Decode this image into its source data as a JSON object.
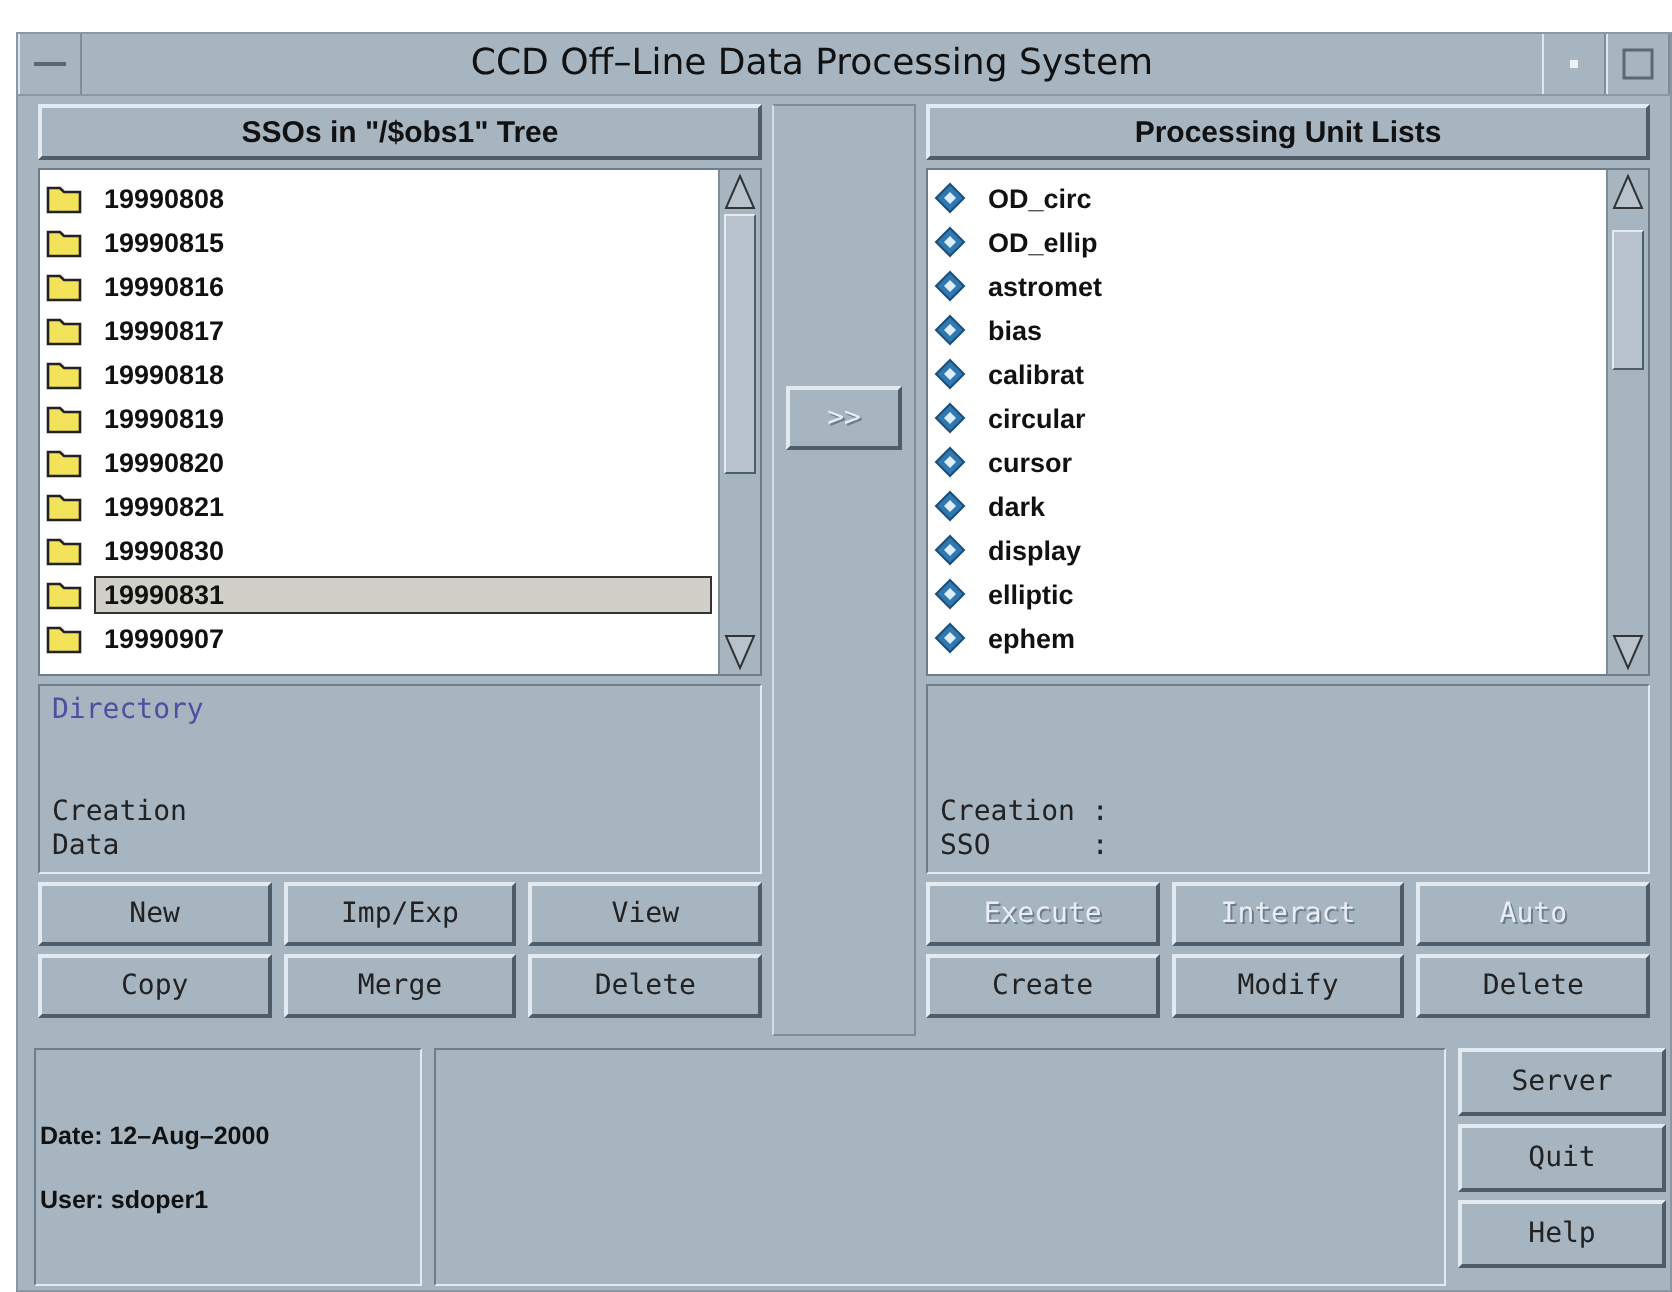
{
  "window": {
    "title": "CCD Off–Line Data Processing System"
  },
  "left_panel": {
    "header": "SSOs in \"/$obs1\" Tree",
    "items": [
      {
        "label": "19990808",
        "selected": false
      },
      {
        "label": "19990815",
        "selected": false
      },
      {
        "label": "19990816",
        "selected": false
      },
      {
        "label": "19990817",
        "selected": false
      },
      {
        "label": "19990818",
        "selected": false
      },
      {
        "label": "19990819",
        "selected": false
      },
      {
        "label": "19990820",
        "selected": false
      },
      {
        "label": "19990821",
        "selected": false
      },
      {
        "label": "19990830",
        "selected": false
      },
      {
        "label": "19990831",
        "selected": true
      },
      {
        "label": "19990907",
        "selected": false
      }
    ],
    "info": [
      {
        "text": "Directory",
        "kind": "title"
      },
      {
        "text": "Creation",
        "kind": "field"
      },
      {
        "text": "Data",
        "kind": "field"
      }
    ],
    "buttons": [
      {
        "label": "New",
        "disabled": false
      },
      {
        "label": "Imp/Exp",
        "disabled": false
      },
      {
        "label": "View",
        "disabled": false
      },
      {
        "label": "Copy",
        "disabled": false
      },
      {
        "label": "Merge",
        "disabled": false
      },
      {
        "label": "Delete",
        "disabled": false
      }
    ]
  },
  "transfer_button": {
    "label": ">>",
    "disabled": true
  },
  "right_panel": {
    "header": "Processing Unit Lists",
    "items": [
      {
        "label": "OD_circ",
        "selected": false
      },
      {
        "label": "OD_ellip",
        "selected": false
      },
      {
        "label": "astromet",
        "selected": false
      },
      {
        "label": "bias",
        "selected": false
      },
      {
        "label": "calibrat",
        "selected": false
      },
      {
        "label": "circular",
        "selected": false
      },
      {
        "label": "cursor",
        "selected": false
      },
      {
        "label": "dark",
        "selected": false
      },
      {
        "label": "display",
        "selected": false
      },
      {
        "label": "elliptic",
        "selected": false
      },
      {
        "label": "ephem",
        "selected": false
      }
    ],
    "info": [
      {
        "text": "Creation :",
        "kind": "field"
      },
      {
        "text": "SSO      :",
        "kind": "field"
      }
    ],
    "buttons": [
      {
        "label": "Execute",
        "disabled": true
      },
      {
        "label": "Interact",
        "disabled": true
      },
      {
        "label": "Auto",
        "disabled": true
      },
      {
        "label": "Create",
        "disabled": false
      },
      {
        "label": "Modify",
        "disabled": false
      },
      {
        "label": "Delete",
        "disabled": false
      }
    ]
  },
  "status": {
    "date": "Date: 12–Aug–2000",
    "user": "User: sdoper1"
  },
  "side_buttons": [
    {
      "label": "Server",
      "disabled": false
    },
    {
      "label": "Quit",
      "disabled": false
    },
    {
      "label": "Help",
      "disabled": false
    }
  ]
}
